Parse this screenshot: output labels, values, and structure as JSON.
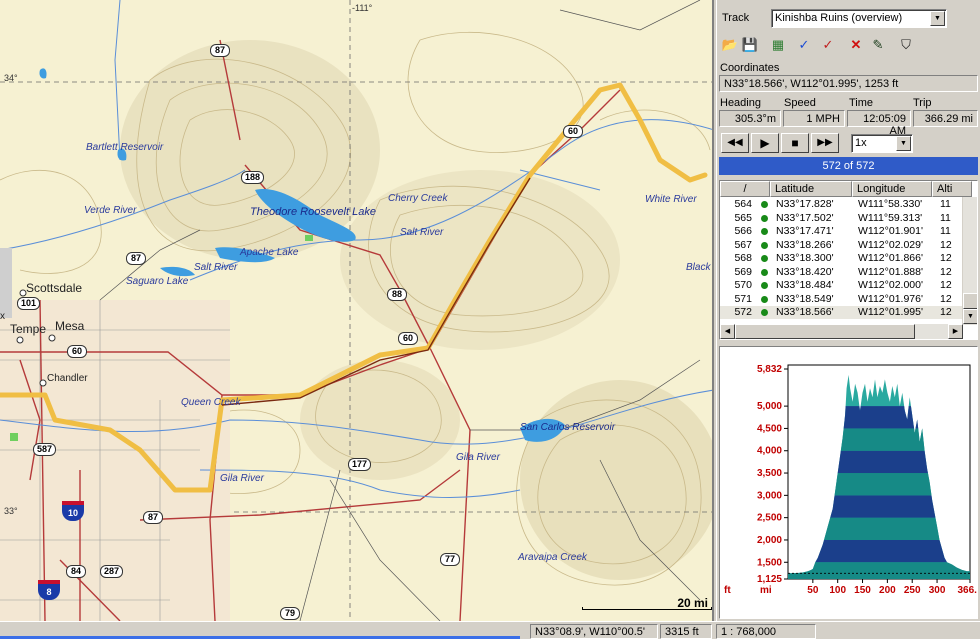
{
  "map": {
    "grid_labels": {
      "top_lon": "-111°",
      "left_lat_1": "34°",
      "left_lat_2": "33°"
    },
    "water_labels": [
      "Bartlett Reservoir",
      "Verde River",
      "Theodore Roosevelt Lake",
      "Cherry Creek",
      "White River",
      "Salt River",
      "Salt River",
      "Apache Lake",
      "Saguaro Lake",
      "Black",
      "Queen Creek",
      "San Carlos Reservoir",
      "Gila River",
      "Gila River",
      "Aravaipa Creek"
    ],
    "cities": [
      "Scottsdale",
      "Tempe",
      "Mesa",
      "Chandler"
    ],
    "route_shields": [
      "87",
      "188",
      "60",
      "87",
      "101",
      "60",
      "88",
      "60",
      "587",
      "177",
      "87",
      "84",
      "287",
      "77",
      "79"
    ],
    "interstates": [
      "10",
      "8"
    ],
    "scale_label": "20 mi",
    "side_label": "x"
  },
  "status": {
    "cursor_coords": "N33°08.9', W110°00.5'",
    "elevation": "3315 ft",
    "scale": "1 : 768,000"
  },
  "panel": {
    "track_label": "Track",
    "track_value": "Kinishba Ruins (overview)",
    "toolbar_icons": [
      "open-folder-icon",
      "save-disk-icon",
      "map-image-icon",
      "pick-point-icon",
      "pick-route-icon",
      "delete-x-icon",
      "edit-pen-icon",
      "binoculars-icon"
    ],
    "coordinates_label": "Coordinates",
    "coordinates_value": "N33°18.566',  W112°01.995',  1253 ft",
    "heading_label": "Heading",
    "heading_value": "305.3°m",
    "speed_label": "Speed",
    "speed_value": "1 MPH",
    "time_label": "Time",
    "time_value": "12:05:09 AM",
    "trip_label": "Trip",
    "trip_value": "366.29 mi",
    "playback_speed": "1x",
    "progress_text": "572 of 572",
    "progress_fraction": 1.0
  },
  "table": {
    "columns": [
      "/",
      "Latitude",
      "Longitude",
      "Alti"
    ],
    "rows": [
      {
        "n": "564",
        "lat": "N33°17.828'",
        "lon": "W111°58.330'",
        "alt": "11"
      },
      {
        "n": "565",
        "lat": "N33°17.502'",
        "lon": "W111°59.313'",
        "alt": "11"
      },
      {
        "n": "566",
        "lat": "N33°17.471'",
        "lon": "W112°01.901'",
        "alt": "11"
      },
      {
        "n": "567",
        "lat": "N33°18.266'",
        "lon": "W112°02.029'",
        "alt": "12"
      },
      {
        "n": "568",
        "lat": "N33°18.300'",
        "lon": "W112°01.866'",
        "alt": "12"
      },
      {
        "n": "569",
        "lat": "N33°18.420'",
        "lon": "W112°01.888'",
        "alt": "12"
      },
      {
        "n": "570",
        "lat": "N33°18.484'",
        "lon": "W112°02.000'",
        "alt": "12"
      },
      {
        "n": "571",
        "lat": "N33°18.549'",
        "lon": "W112°01.976'",
        "alt": "12"
      },
      {
        "n": "572",
        "lat": "N33°18.566'",
        "lon": "W112°01.995'",
        "alt": "12"
      }
    ]
  },
  "chart_data": {
    "type": "area",
    "ylabel": "ft",
    "xlabel": "mi",
    "y_ticks": [
      "5,832",
      "5,000",
      "4,500",
      "4,000",
      "3,500",
      "3,000",
      "2,500",
      "2,000",
      "1,500",
      "1,125"
    ],
    "y_tick_values": [
      5832,
      5000,
      4500,
      4000,
      3500,
      3000,
      2500,
      2000,
      1500,
      1125
    ],
    "x_ticks": [
      "50",
      "100",
      "150",
      "200",
      "250",
      "300",
      "366.3"
    ],
    "x_tick_values": [
      50,
      100,
      150,
      200,
      250,
      300,
      366.3
    ],
    "xlim": [
      0,
      366.3
    ],
    "ylim": [
      1125,
      5832
    ],
    "x": [
      0,
      10,
      20,
      30,
      40,
      45,
      50,
      55,
      60,
      70,
      80,
      90,
      95,
      100,
      105,
      110,
      115,
      118,
      122,
      125,
      130,
      135,
      140,
      145,
      150,
      155,
      160,
      165,
      170,
      175,
      180,
      185,
      190,
      195,
      200,
      205,
      210,
      215,
      220,
      225,
      230,
      235,
      240,
      245,
      250,
      255,
      260,
      265,
      270,
      275,
      280,
      285,
      290,
      295,
      300,
      305,
      310,
      315,
      320,
      330,
      340,
      350,
      360,
      366.3
    ],
    "y": [
      1253,
      1253,
      1260,
      1270,
      1300,
      1320,
      1350,
      1500,
      1600,
      1900,
      2300,
      2700,
      3100,
      3500,
      3900,
      4300,
      4800,
      5400,
      5700,
      5400,
      5100,
      5500,
      5300,
      4900,
      5300,
      5500,
      5100,
      5400,
      5200,
      5600,
      5200,
      5450,
      5300,
      5600,
      5300,
      5100,
      5450,
      5200,
      5500,
      5000,
      5300,
      4900,
      4700,
      5200,
      4800,
      4400,
      4700,
      4200,
      4500,
      4000,
      3600,
      3300,
      2900,
      2600,
      2300,
      2000,
      1800,
      1600,
      1500,
      1450,
      1380,
      1330,
      1300,
      1300
    ],
    "band_colors": [
      "#1b3f8b",
      "#168a86"
    ],
    "fill_top_color": "#2aa9a0"
  }
}
